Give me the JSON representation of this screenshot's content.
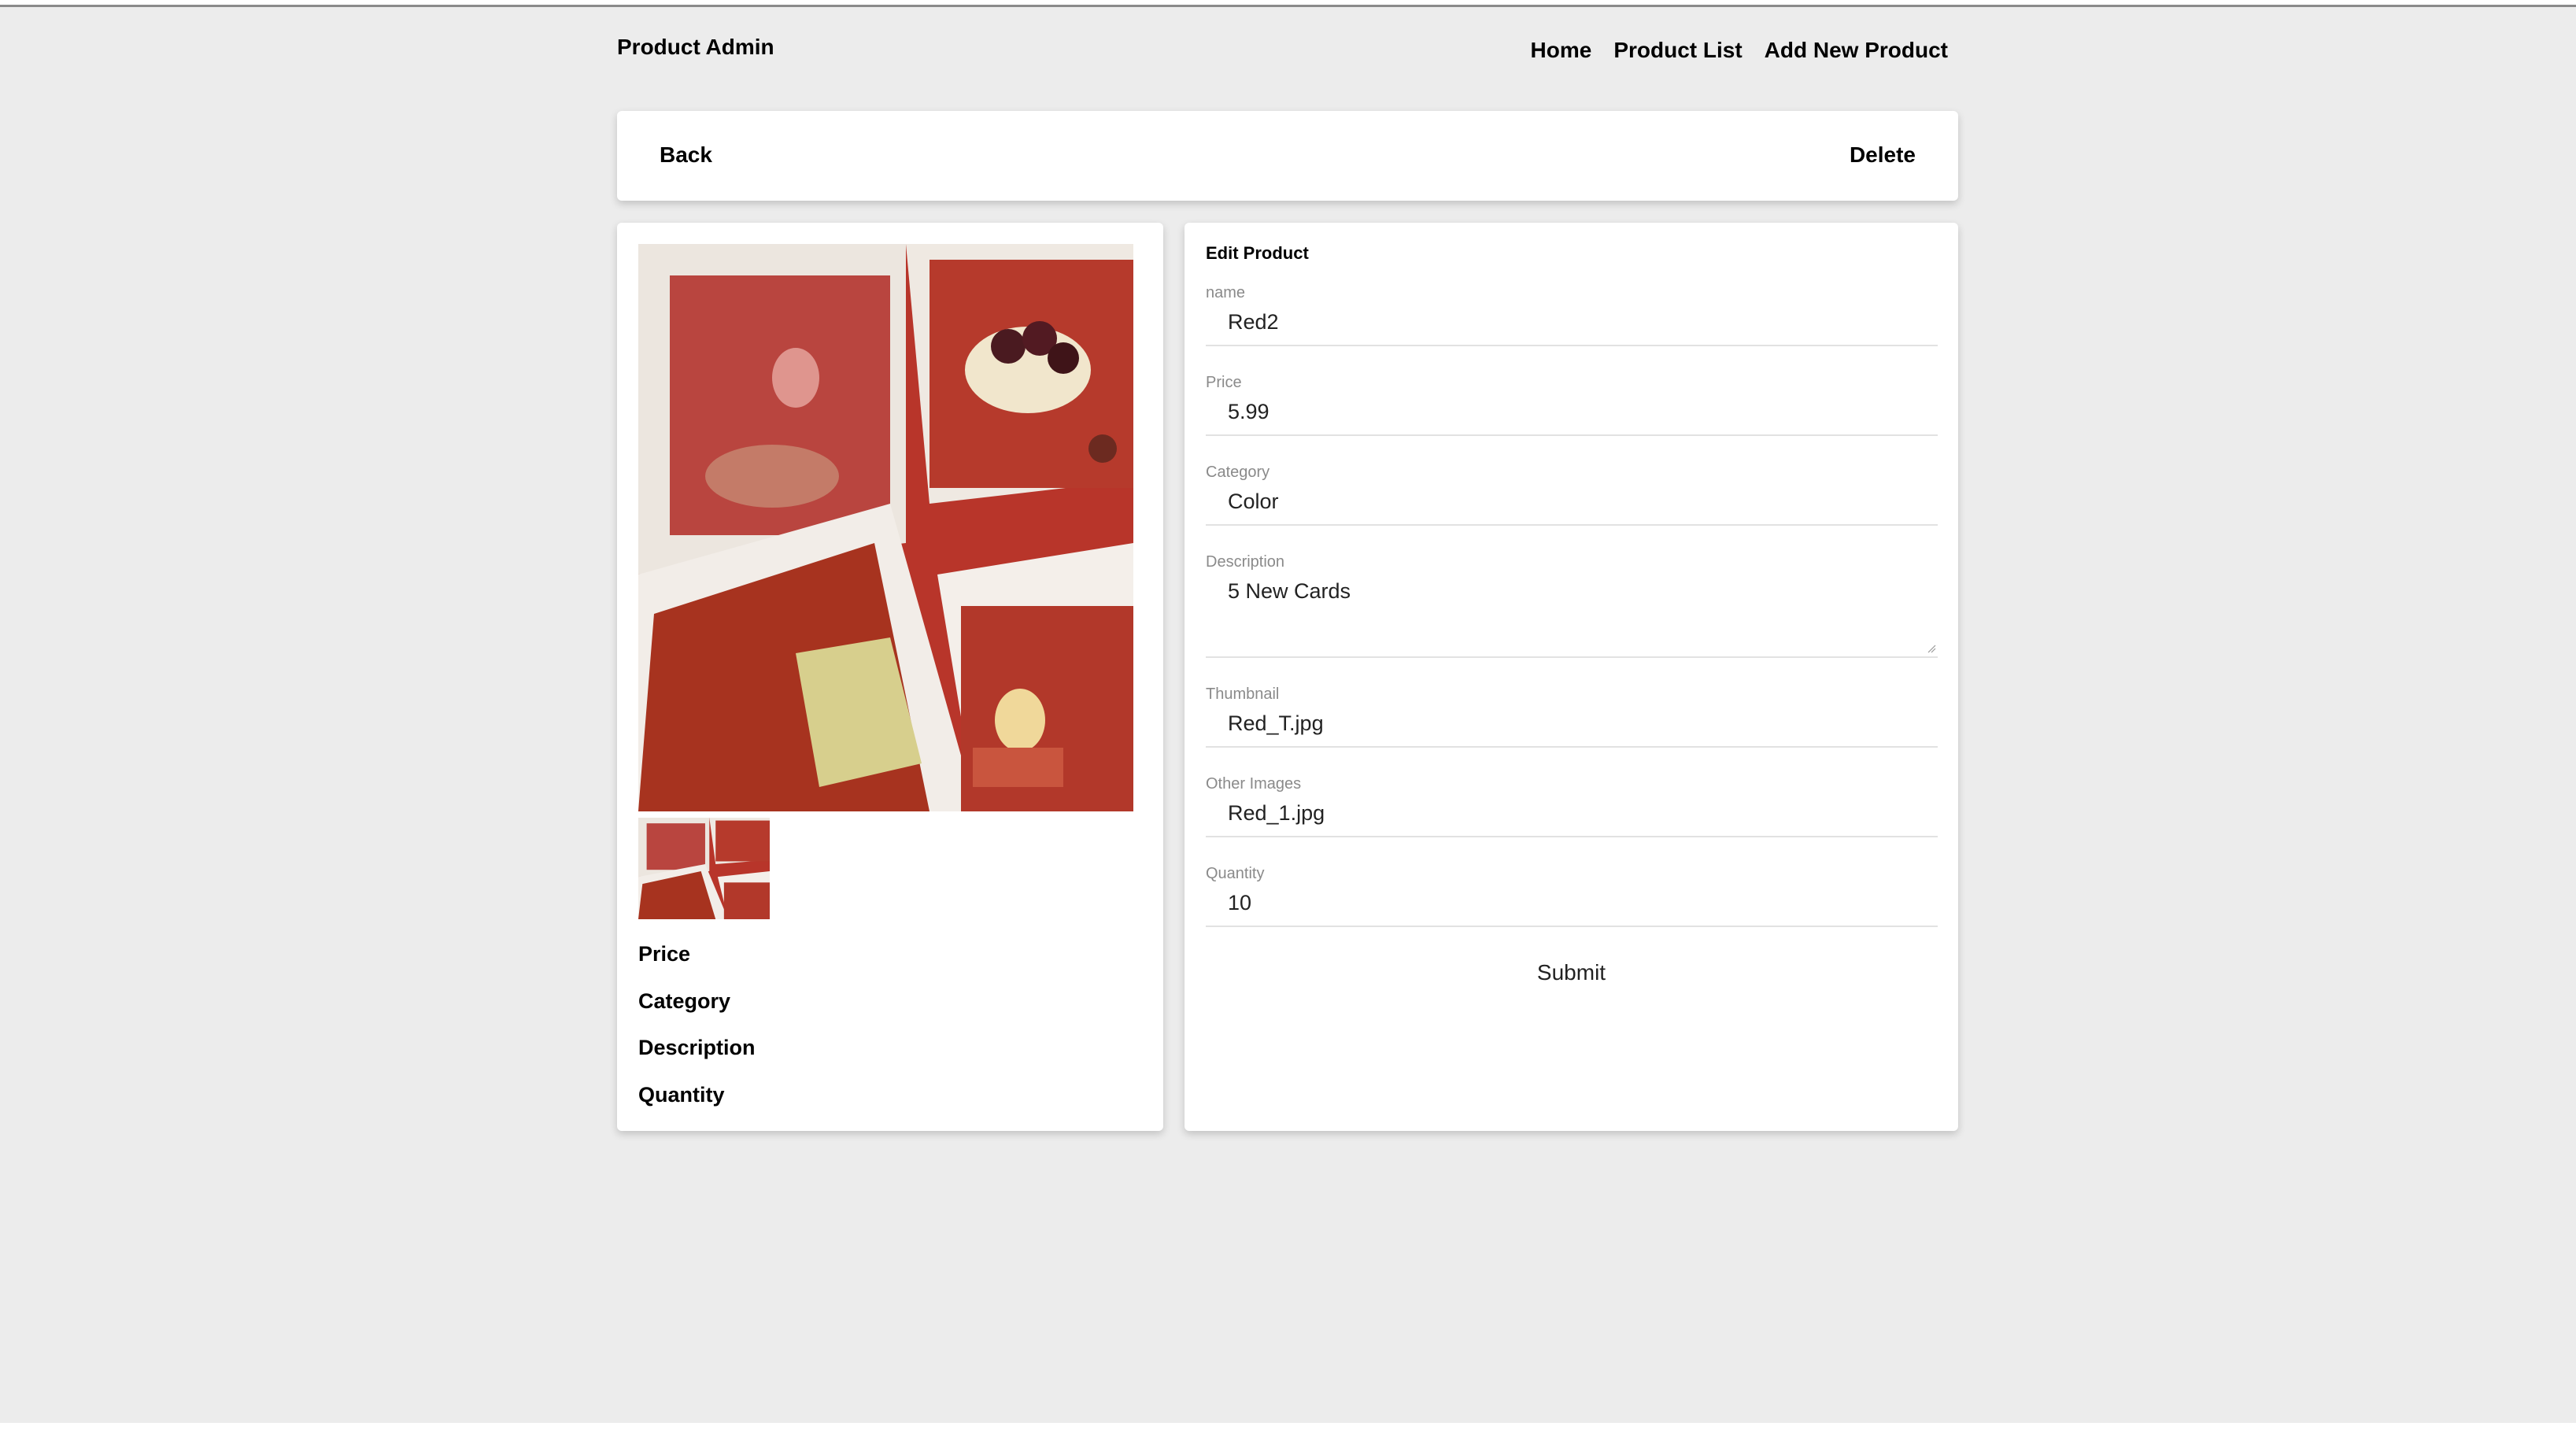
{
  "header": {
    "brand": "Product Admin",
    "nav": [
      "Home",
      "Product List",
      "Add New Product"
    ]
  },
  "toolbar": {
    "back_label": "Back",
    "delete_label": "Delete"
  },
  "product_detail": {
    "image_description": "collage of red photo cards",
    "labels": [
      "Price",
      "Category",
      "Description",
      "Quantity"
    ]
  },
  "form": {
    "title": "Edit Product",
    "fields": [
      {
        "label": "name",
        "value": "Red2"
      },
      {
        "label": "Price",
        "value": "5.99"
      },
      {
        "label": "Category",
        "value": "Color"
      },
      {
        "label": "Description",
        "value": "5 New Cards"
      },
      {
        "label": "Thumbnail",
        "value": "Red_T.jpg"
      },
      {
        "label": "Other Images",
        "value": "Red_1.jpg"
      },
      {
        "label": "Quantity",
        "value": "10"
      }
    ],
    "submit_label": "Submit"
  },
  "colors": {
    "page_bg": "#ececec",
    "card_bg": "#ffffff",
    "photo_red": "#c43c2a"
  }
}
